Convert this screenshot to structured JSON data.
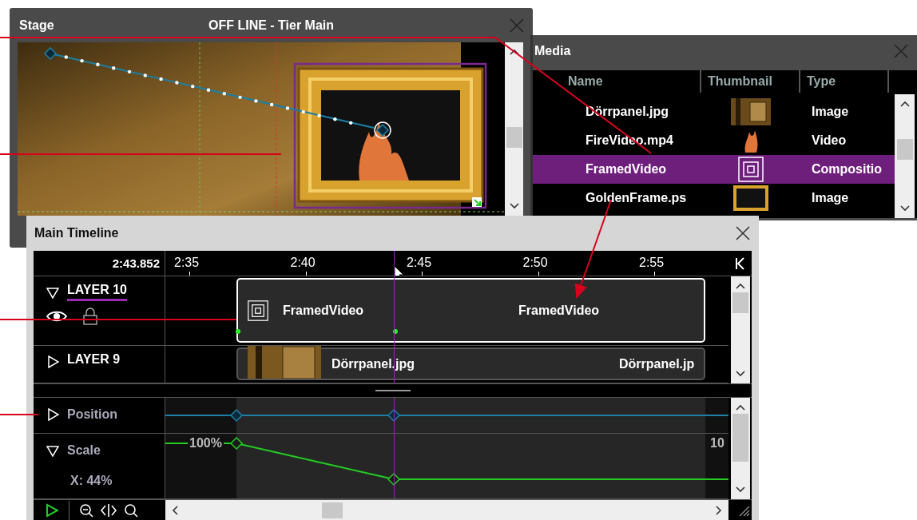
{
  "stage": {
    "title": "Stage",
    "status": "OFF LINE - Tier Main"
  },
  "media": {
    "title": "Media",
    "columns": [
      "Name",
      "Thumbnail",
      "Type"
    ],
    "rows": [
      {
        "name": "Dörrpanel.jpg",
        "kind": "door",
        "type": "Image",
        "selected": false
      },
      {
        "name": "FireVideo.mp4",
        "kind": "fire",
        "type": "Video",
        "selected": false
      },
      {
        "name": "FramedVideo",
        "kind": "composition",
        "type": "Compositio",
        "selected": true
      },
      {
        "name": "GoldenFrame.ps",
        "kind": "frame",
        "type": "Image",
        "selected": false
      }
    ]
  },
  "timeline": {
    "title": "Main Timeline",
    "current_time": "2:43.852",
    "ticks": [
      "2:35",
      "2:40",
      "2:45",
      "2:50",
      "2:55"
    ],
    "layers": [
      {
        "name": "LAYER 10",
        "expanded": true,
        "selected": true,
        "clip": {
          "kind": "composition",
          "selected": true,
          "labels": [
            "FramedVideo",
            "FramedVideo"
          ]
        }
      },
      {
        "name": "LAYER 9",
        "expanded": false,
        "selected": false,
        "clip": {
          "kind": "image",
          "selected": false,
          "labels": [
            "Dörrpanel.jpg",
            "Dörrpanel.jp"
          ]
        }
      }
    ],
    "properties": [
      {
        "name": "Position",
        "kind": "position",
        "expanded": false
      },
      {
        "name": "Scale",
        "kind": "scale",
        "expanded": true,
        "reading": "X: 44%",
        "start_value": "100%",
        "end_value": "10"
      }
    ]
  }
}
